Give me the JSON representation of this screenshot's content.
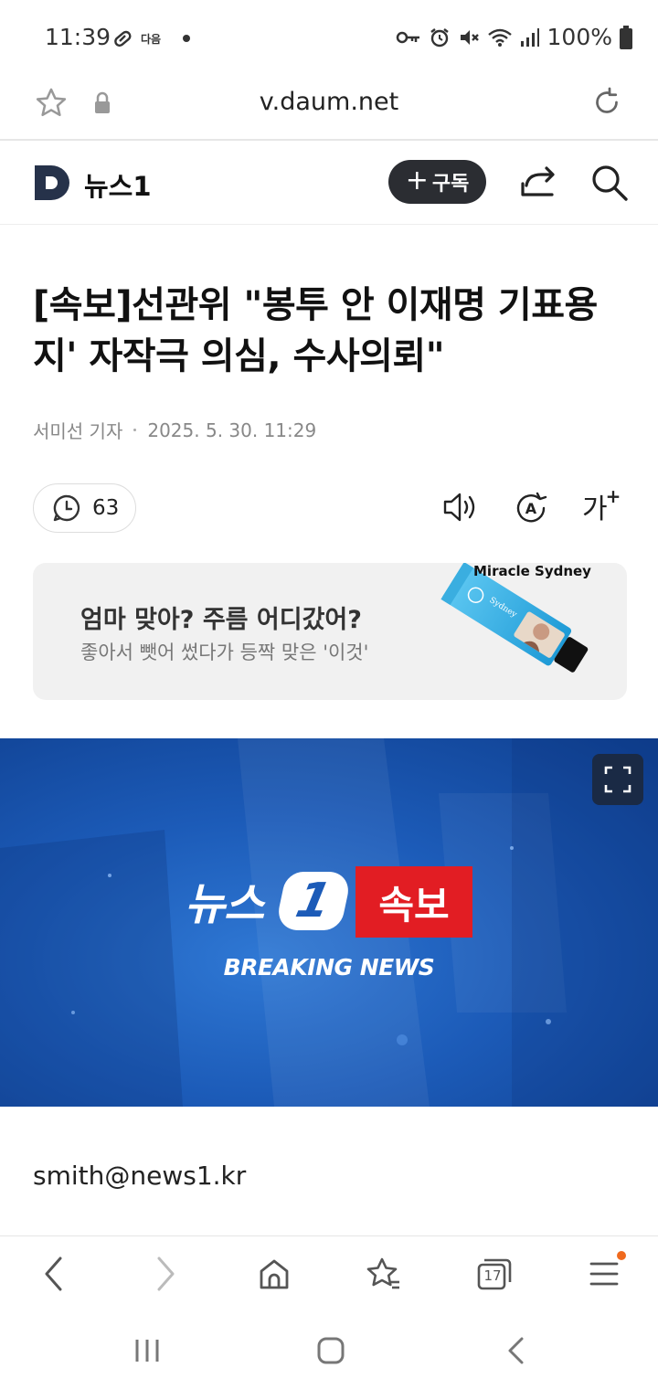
{
  "status_bar": {
    "time": "11:39",
    "small_label": "다음",
    "battery": "100%"
  },
  "url_bar": {
    "url": "v.daum.net"
  },
  "site_header": {
    "logo_letter": "D",
    "site_name": "뉴스1",
    "subscribe_label": "구독",
    "subscribe_plus": "+"
  },
  "article": {
    "headline": "[속보]선관위 \"봉투 안 이재명 기표용지' 자작극 의심, 수사의뢰\"",
    "reporter": "서미선 기자",
    "datetime": "2025. 5. 30. 11:29",
    "comment_count": "63",
    "font_tool_label": "가",
    "font_tool_plus": "+",
    "body_email": "smith@news1.kr"
  },
  "ad": {
    "title": "엄마 맞아? 주름 어디갔어?",
    "subtitle": "좋아서 뺏어 썼다가 등짝 맞은 '이것'",
    "brand": "Miracle Sydney"
  },
  "hero": {
    "logo_text": "뉴스",
    "logo_number": "1",
    "badge": "속보",
    "caption": "BREAKING NEWS"
  },
  "browser_nav": {
    "tabs_count": "17"
  },
  "colors": {
    "subscribe_bg": "#2b2d32",
    "breaking_red": "#e21d23",
    "hero_blue": "#1c5bb8",
    "menu_dot": "#f06a1e"
  }
}
